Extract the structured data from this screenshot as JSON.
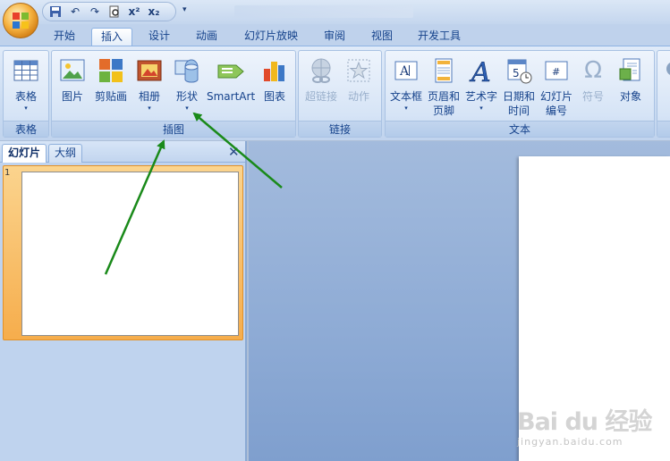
{
  "quick_access": {
    "items": [
      "save-icon",
      "undo-icon",
      "redo-icon",
      "print-preview-icon",
      "superscript-icon",
      "subscript-icon",
      "customize-icon"
    ]
  },
  "tabs": [
    {
      "label": "开始"
    },
    {
      "label": "插入",
      "active": true
    },
    {
      "label": "设计"
    },
    {
      "label": "动画"
    },
    {
      "label": "幻灯片放映"
    },
    {
      "label": "审阅"
    },
    {
      "label": "视图"
    },
    {
      "label": "开发工具"
    }
  ],
  "ribbon": {
    "groups": {
      "table": {
        "label": "表格",
        "buttons": {
          "table": "表格"
        }
      },
      "illustrations": {
        "label": "插图",
        "buttons": {
          "picture": "图片",
          "clipart": "剪贴画",
          "album": "相册",
          "shapes": "形状",
          "smartart": "SmartArt",
          "chart": "图表"
        }
      },
      "links": {
        "label": "链接",
        "buttons": {
          "hyperlink": "超链接",
          "action": "动作"
        }
      },
      "text": {
        "label": "文本",
        "buttons": {
          "textbox": "文本框",
          "header_footer_1": "页眉和",
          "header_footer_2": "页脚",
          "wordart": "艺术字",
          "datetime_1": "日期和",
          "datetime_2": "时间",
          "slide_number_1": "幻灯片",
          "slide_number_2": "编号",
          "symbol": "符号",
          "object": "对象"
        }
      }
    }
  },
  "slide_pane": {
    "tabs": {
      "slides": "幻灯片",
      "outline": "大纲"
    },
    "close": "✕",
    "slide_number": "1"
  },
  "colors": {
    "ribbon_bg": "#dbe7f7",
    "selected_thumb": "#f6ad4c",
    "annotation_arrow": "#1a8a1a"
  },
  "watermark": {
    "logo": "Bai du 经验",
    "url": "jingyan.baidu.com"
  }
}
